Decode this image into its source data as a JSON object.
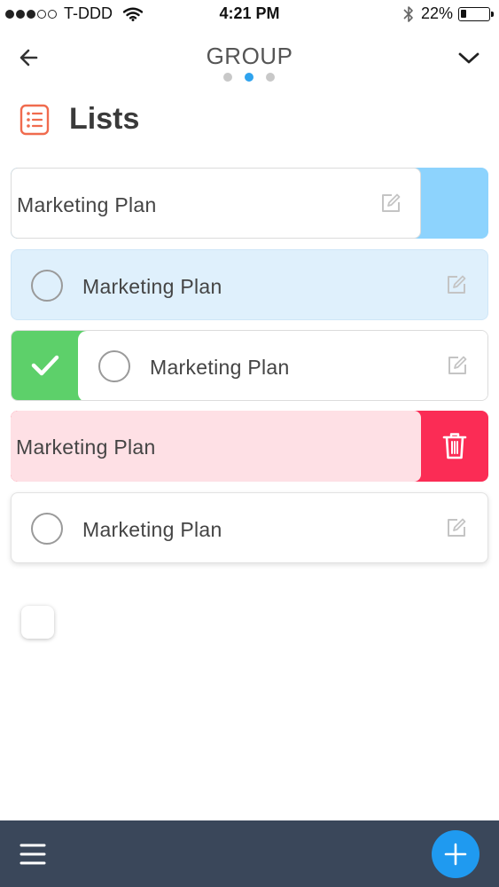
{
  "status_bar": {
    "signal_bars_filled": 3,
    "signal_bars_total": 5,
    "carrier": "T-DDD",
    "time": "4:21 PM",
    "battery_percent": "22%",
    "battery_level": 0.22,
    "wifi_icon": "wifi-icon",
    "bluetooth_icon": "bluetooth-icon"
  },
  "header": {
    "title": "GROUP",
    "back_icon": "arrow-left-icon",
    "menu_icon": "chevron-down-icon",
    "page_indicator": {
      "count": 3,
      "active_index": 1
    }
  },
  "section": {
    "title": "Lists",
    "icon": "list-icon"
  },
  "lists": [
    {
      "label": "Marketing Plan",
      "state": "swiped-left-blue"
    },
    {
      "label": "Marketing Plan",
      "state": "selected"
    },
    {
      "label": "Marketing Plan",
      "state": "swiped-right-complete"
    },
    {
      "label": "Marketing Plan",
      "state": "swiped-left-delete"
    },
    {
      "label": "Marketing Plan",
      "state": "normal"
    }
  ],
  "bottom_bar": {
    "menu_icon": "hamburger-icon",
    "add_icon": "plus-icon"
  },
  "colors": {
    "accent": "#2fa3ee",
    "fab": "#1f9af0",
    "swipe_blue": "#8dd3fd",
    "selected_bg": "#dff0fc",
    "complete_green": "#5dd06a",
    "delete_red": "#fb2c55",
    "delete_bg": "#fee0e5",
    "bottom_bar": "#3a475a",
    "section_icon": "#f06b4e"
  }
}
